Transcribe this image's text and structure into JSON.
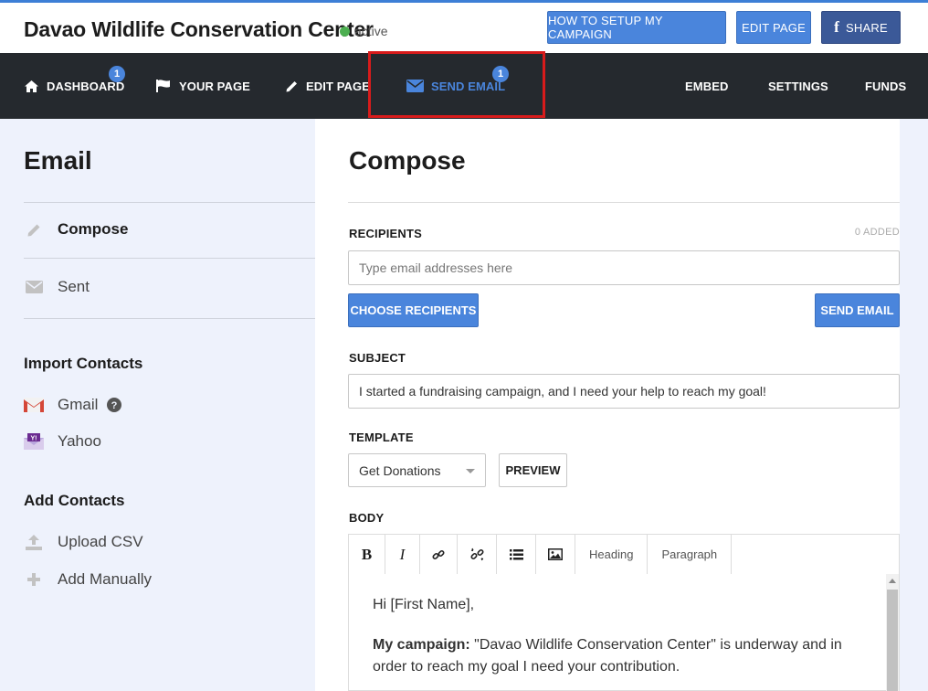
{
  "header": {
    "campaign_title": "Davao Wildlife Conservation Center",
    "status": "active",
    "buttons": {
      "how_to": "HOW TO SETUP MY CAMPAIGN",
      "edit_page": "EDIT PAGE",
      "share": "SHARE"
    }
  },
  "nav": {
    "items": [
      {
        "label": "DASHBOARD",
        "icon": "home-icon",
        "badge": "1"
      },
      {
        "label": "YOUR PAGE",
        "icon": "flag-icon"
      },
      {
        "label": "EDIT PAGE",
        "icon": "pencil-icon"
      },
      {
        "label": "SEND EMAIL",
        "icon": "envelope-icon",
        "badge": "1",
        "active": true
      },
      {
        "label": "EMBED"
      },
      {
        "label": "SETTINGS"
      },
      {
        "label": "FUNDS"
      }
    ]
  },
  "sidebar": {
    "title": "Email",
    "items": [
      {
        "label": "Compose",
        "icon": "pencil-icon"
      },
      {
        "label": "Sent",
        "icon": "envelope-icon"
      }
    ],
    "import_heading": "Import Contacts",
    "import_items": [
      {
        "label": "Gmail",
        "icon": "gmail-icon"
      },
      {
        "label": "Yahoo",
        "icon": "yahoo-icon"
      }
    ],
    "add_heading": "Add Contacts",
    "add_items": [
      {
        "label": "Upload CSV",
        "icon": "upload-icon"
      },
      {
        "label": "Add Manually",
        "icon": "plus-icon"
      }
    ]
  },
  "compose": {
    "title": "Compose",
    "recipients_label": "RECIPIENTS",
    "added_count": "0 ADDED",
    "recipients_placeholder": "Type email addresses here",
    "choose_recipients": "CHOOSE RECIPIENTS",
    "send_email": "SEND EMAIL",
    "subject_label": "SUBJECT",
    "subject_value": "I started a fundraising campaign, and I need your help to reach my goal!",
    "template_label": "TEMPLATE",
    "template_value": "Get Donations",
    "preview": "PREVIEW",
    "body_label": "BODY",
    "toolbar": {
      "bold": "B",
      "italic": "I",
      "heading": "Heading",
      "paragraph": "Paragraph"
    },
    "body": {
      "greeting": "Hi [First Name],",
      "campaign_label": "My campaign:",
      "campaign_text": " \"Davao Wildlife Conservation Center\" is underway and in order to reach my goal I need your contribution."
    }
  },
  "colors": {
    "accent": "#4a85dc",
    "nav_bg": "#25292e",
    "sidebar_bg": "#eef2fc",
    "highlight": "#d81b1b",
    "status": "#4caf50"
  }
}
